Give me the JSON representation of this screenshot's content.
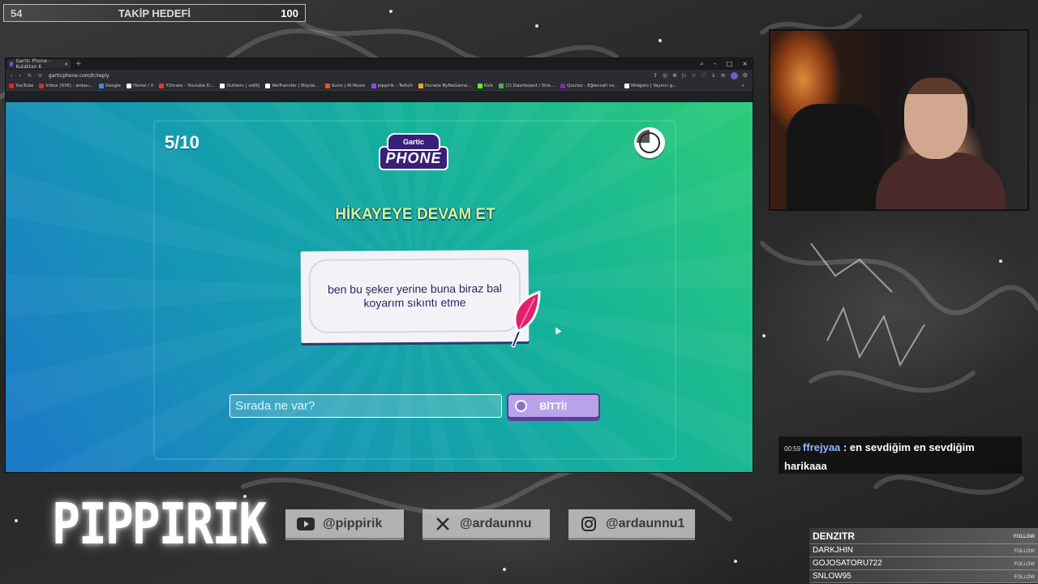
{
  "overlay": {
    "goal": {
      "current": "54",
      "title": "TAKİP HEDEFİ",
      "target": "100"
    },
    "brand": "PIPPIRIK",
    "socials": [
      {
        "icon": "youtube-icon",
        "handle": "@pippirik"
      },
      {
        "icon": "x-icon",
        "handle": "@ardaunnu"
      },
      {
        "icon": "instagram-icon",
        "handle": "@ardaunnu1"
      }
    ],
    "chat": {
      "time": "00:59",
      "user": "ffrejyaa",
      "message": ": en sevdiğim en sevdiğim harikaaa"
    },
    "follows": [
      {
        "name": "DENZITR",
        "action": "FOLLOW"
      },
      {
        "name": "DARKJHIN",
        "action": "FOLLOW"
      },
      {
        "name": "GOJOSATORU722",
        "action": "FOLLOW"
      },
      {
        "name": "SNLOW95",
        "action": "FOLLOW"
      }
    ]
  },
  "browser": {
    "tab_title": "Gartic Phone - Kulaktan K",
    "url": "garticphone.com/tr/reply",
    "bookmarks": [
      {
        "label": "YouTube",
        "color": "#e62117"
      },
      {
        "label": "Inbox (936) - ardau...",
        "color": "#d93025"
      },
      {
        "label": "Google",
        "color": "#4285f4"
      },
      {
        "label": "Home / X",
        "color": "#ffffff"
      },
      {
        "label": "Y2mate - Youtube D...",
        "color": "#e53935"
      },
      {
        "label": "Outliers | vidIQ",
        "color": "#ffffff"
      },
      {
        "label": "WeTransfer | Büyük...",
        "color": "#ffffff"
      },
      {
        "label": "Suno | AI Music",
        "color": "#f4511e"
      },
      {
        "label": "pippirik - Twitch",
        "color": "#9146ff"
      },
      {
        "label": "Donate ByNoGame...",
        "color": "#f9a825"
      },
      {
        "label": "Kick",
        "color": "#53fc18"
      },
      {
        "label": "(2) Dashboard / Stre...",
        "color": "#4caf50"
      },
      {
        "label": "Quizizz - Eğlenceli ve...",
        "color": "#8e24aa"
      },
      {
        "label": "Widgets | Yayıncı g...",
        "color": "#ffffff"
      }
    ]
  },
  "game": {
    "round": "5/10",
    "logo_top": "Gartic",
    "logo_bottom": "PHONE",
    "heading": "HİKAYEYE DEVAM ET",
    "prompt": "ben bu şeker yerine buna biraz bal koyarım sıkıntı etme",
    "input_placeholder": "Sırada ne var?",
    "done_label": "BİTTİ!"
  }
}
